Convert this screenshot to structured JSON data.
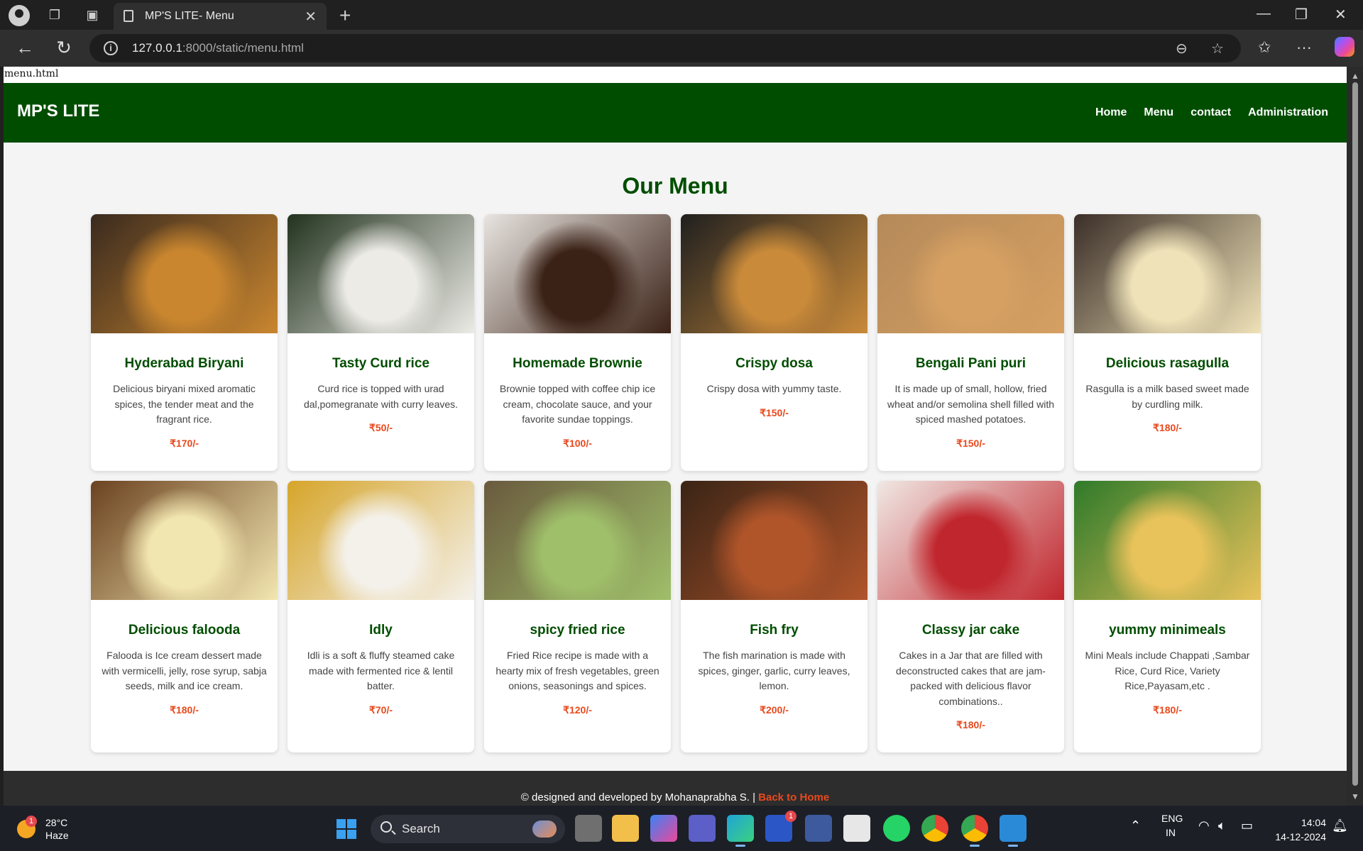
{
  "browser": {
    "tab_title": "MP'S LITE- Menu",
    "url_host": "127.0.0.1",
    "url_rest": ":8000/static/menu.html"
  },
  "page": {
    "file_label": "menu.html",
    "brand": "MP'S LITE",
    "nav": [
      "Home",
      "Menu",
      "contact",
      "Administration"
    ],
    "heading": "Our Menu",
    "footer_text": "© designed and developed by Mohanaprabha S. | ",
    "footer_link": "Back to Home"
  },
  "menu_items": [
    {
      "name": "Hyderabad Biryani",
      "description": "Delicious biryani mixed aromatic spices, the tender meat and the fragrant rice.",
      "price": "₹170/-",
      "image_colors": [
        "#3a2a1e",
        "#c9862f"
      ]
    },
    {
      "name": "Tasty Curd rice",
      "description": "Curd rice is topped with urad dal,pomegranate with curry leaves.",
      "price": "₹50/-",
      "image_colors": [
        "#22321e",
        "#ecebe6"
      ]
    },
    {
      "name": "Homemade Brownie",
      "description": "Brownie topped with coffee chip ice cream, chocolate sauce, and your favorite sundae toppings.",
      "price": "₹100/-",
      "image_colors": [
        "#e8e4e0",
        "#3b2217"
      ]
    },
    {
      "name": "Crispy dosa",
      "description": "Crispy dosa with yummy taste.",
      "price": "₹150/-",
      "image_colors": [
        "#1f1f1f",
        "#c98a3a"
      ]
    },
    {
      "name": "Bengali Pani puri",
      "description": "It is made up of small, hollow, fried wheat and/or semolina shell filled with spiced mashed potatoes.",
      "price": "₹150/-",
      "image_colors": [
        "#b58a5a",
        "#d6a062"
      ]
    },
    {
      "name": "Delicious rasagulla",
      "description": "Rasgulla is a milk based sweet made by curdling milk.",
      "price": "₹180/-",
      "image_colors": [
        "#3a2e28",
        "#efe2b8"
      ]
    },
    {
      "name": "Delicious falooda",
      "description": "Falooda is Ice cream dessert made with vermicelli, jelly, rose syrup, sabja seeds, milk and ice cream.",
      "price": "₹180/-",
      "image_colors": [
        "#6b4220",
        "#f2e6b0"
      ]
    },
    {
      "name": "Idly",
      "description": "Idli is a soft & fluffy steamed cake made with fermented rice & lentil batter.",
      "price": "₹70/-",
      "image_colors": [
        "#d6a52a",
        "#f4f1ea"
      ]
    },
    {
      "name": "spicy fried rice",
      "description": "Fried Rice recipe is made with a hearty mix of fresh vegetables, green onions, seasonings and spices.",
      "price": "₹120/-",
      "image_colors": [
        "#6a5a3e",
        "#9fbf6a"
      ]
    },
    {
      "name": "Fish fry",
      "description": "The fish marination is made with spices, ginger, garlic, curry leaves, lemon.",
      "price": "₹200/-",
      "image_colors": [
        "#3a2416",
        "#b0552a"
      ]
    },
    {
      "name": "Classy jar cake",
      "description": "Cakes in a Jar that are filled with deconstructed cakes that are jam-packed with delicious flavor combinations..",
      "price": "₹180/-",
      "image_colors": [
        "#f0e8e4",
        "#c0262d"
      ]
    },
    {
      "name": "yummy minimeals",
      "description": "Mini Meals include Chappati ,Sambar Rice, Curd Rice, Variety Rice,Payasam,etc .",
      "price": "₹180/-",
      "image_colors": [
        "#2f7a2a",
        "#e8c25a"
      ]
    }
  ],
  "taskbar": {
    "weather_badge": "1",
    "temperature": "28°C",
    "condition": "Haze",
    "search_label": "Search",
    "app_badge": "1",
    "lang_top": "ENG",
    "lang_bottom": "IN",
    "time": "14:04",
    "date": "14-12-2024"
  },
  "colors": {
    "header_green": "#004d00",
    "accent_orange": "#e8491d"
  }
}
